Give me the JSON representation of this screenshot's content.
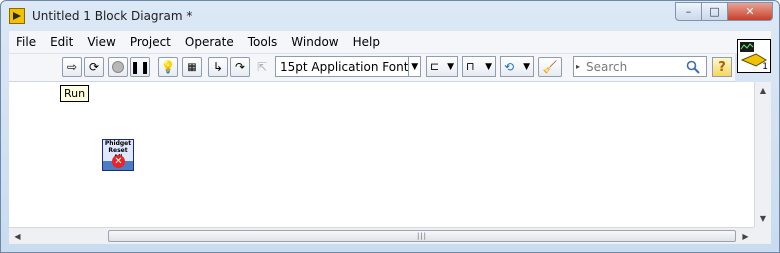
{
  "window": {
    "title": "Untitled 1 Block Diagram *",
    "buttons": {
      "minimize": "–",
      "maximize": "□",
      "close": "✕"
    }
  },
  "menu": {
    "items": [
      "File",
      "Edit",
      "View",
      "Project",
      "Operate",
      "Tools",
      "Window",
      "Help"
    ]
  },
  "toolbar": {
    "font_select": "15pt Application Font",
    "search_placeholder": "Search",
    "help_label": "?"
  },
  "canvas": {
    "tooltip": "Run",
    "subvi": {
      "line1": "Phidget",
      "line2": "Reset All"
    }
  },
  "vi_icon": {
    "number": "1"
  },
  "colors": {
    "title_bar": "#c9dcf0",
    "close_button": "#c6402a",
    "subvi_fill": "#4a7cc8"
  }
}
